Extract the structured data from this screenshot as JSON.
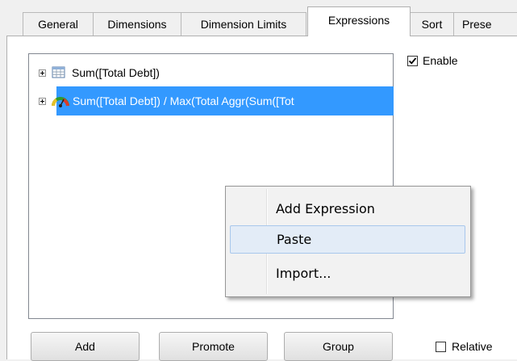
{
  "tabs": [
    {
      "label": "General"
    },
    {
      "label": "Dimensions"
    },
    {
      "label": "Dimension Limits"
    },
    {
      "label": "Expressions",
      "active": true
    },
    {
      "label": "Sort"
    },
    {
      "label": "Prese"
    }
  ],
  "expressions": {
    "items": [
      {
        "text": "Sum([Total Debt])",
        "icon": "table-grid-icon"
      },
      {
        "text": "Sum([Total Debt]) / Max(Total Aggr(Sum([Tot",
        "icon": "gauge-icon",
        "selected": true
      }
    ]
  },
  "options": {
    "enable_label": "Enable",
    "enable_checked": true,
    "relative_label": "Relative",
    "relative_checked": false
  },
  "buttons": {
    "add": "Add",
    "promote": "Promote",
    "group": "Group"
  },
  "context_menu": {
    "items": [
      {
        "label": "Add Expression"
      },
      {
        "label": "Paste",
        "highlighted": true
      },
      {
        "label": "Import..."
      }
    ]
  },
  "colors": {
    "selection": "#3399ff",
    "menu_highlight": "#e3ecf7"
  }
}
